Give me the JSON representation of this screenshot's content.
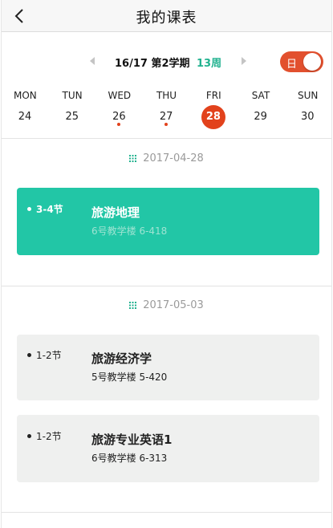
{
  "header": {
    "title": "我的课表"
  },
  "term_bar": {
    "term": "16/17 第2学期",
    "week": "13周",
    "toggle_label": "日"
  },
  "week": {
    "days": [
      {
        "name": "MON",
        "num": "24"
      },
      {
        "name": "TUN",
        "num": "25"
      },
      {
        "name": "WED",
        "num": "26"
      },
      {
        "name": "THU",
        "num": "27"
      },
      {
        "name": "FRI",
        "num": "28"
      },
      {
        "name": "SAT",
        "num": "29"
      },
      {
        "name": "SUN",
        "num": "30"
      }
    ]
  },
  "sections": [
    {
      "date": "2017-04-28",
      "courses": [
        {
          "period": "3-4节",
          "name": "旅游地理",
          "location": "6号教学楼 6-418"
        }
      ]
    },
    {
      "date": "2017-05-03",
      "courses": [
        {
          "period": "1-2节",
          "name": "旅游经济学",
          "location": "5号教学楼 5-420"
        },
        {
          "period": "1-2节",
          "name": "旅游专业英语1",
          "location": "6号教学楼 6-313"
        }
      ]
    }
  ],
  "colors": {
    "accent_green": "#21b28f",
    "card_green": "#22c6a6",
    "accent_red": "#e2421c",
    "card_gray": "#eff0ef"
  }
}
